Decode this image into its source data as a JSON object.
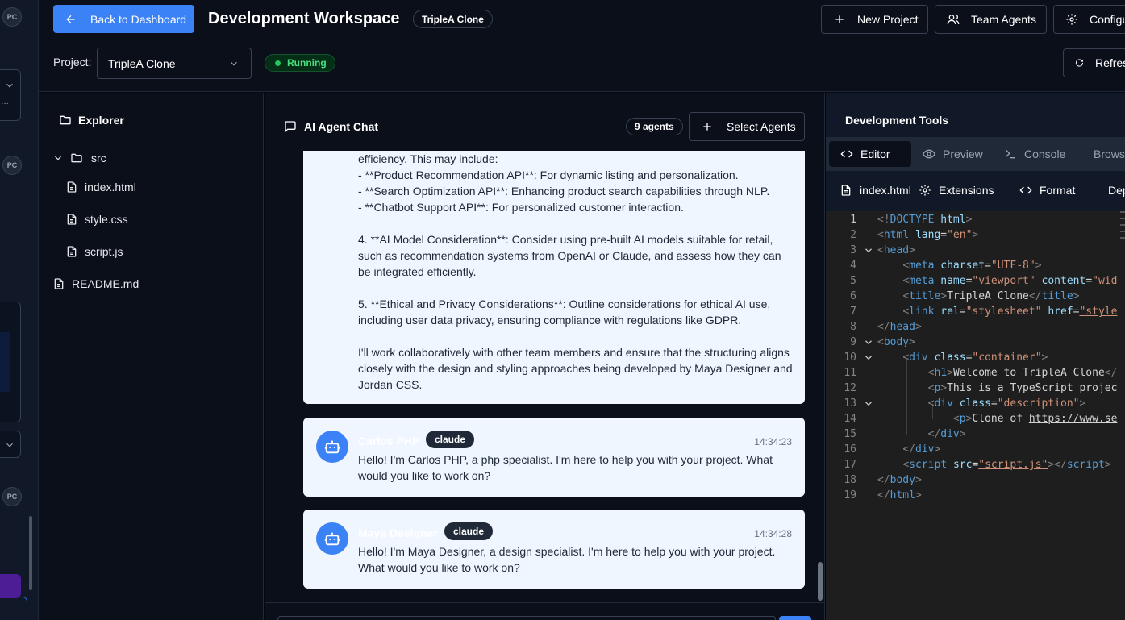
{
  "header": {
    "back_label": "Back to Dashboard",
    "title": "Development Workspace",
    "project_tag": "TripleA Clone",
    "new_project_label": "New Project",
    "team_agents_label": "Team Agents",
    "configure_label": "Configure",
    "refresh_label": "Refresh",
    "project_label": "Project:",
    "project_value": "TripleA Clone",
    "status": "Running"
  },
  "rail": {
    "avatars": [
      "PC",
      "PC",
      "PC"
    ]
  },
  "explorer": {
    "title": "Explorer",
    "folder": "src",
    "files": [
      "index.html",
      "style.css",
      "script.js"
    ],
    "root_files": [
      "README.md"
    ]
  },
  "chat": {
    "title": "AI Agent Chat",
    "agent_count": "9 agents",
    "select_agents_label": "Select Agents",
    "messages": [
      {
        "text": "efficiency. This may include:\n   - **Product Recommendation API**: For dynamic listing and personalization.\n   - **Search Optimization API**: Enhancing product search capabilities through NLP.\n   - **Chatbot Support API**: For personalized customer interaction.\n\n4. **AI Model Consideration**: Consider using pre-built AI models suitable for retail, such as recommendation systems from OpenAI or Claude, and assess how they can be integrated efficiently.\n\n5. **Ethical and Privacy Considerations**: Outline considerations for ethical AI use, including user data privacy, ensuring compliance with regulations like GDPR.\n\nI'll work collaboratively with other team members and ensure that the structuring aligns closely with the design and styling approaches being developed by Maya Designer and Jordan CSS."
      },
      {
        "agent": "Carlos PHP",
        "model": "claude",
        "time": "14:34:23",
        "text": "Hello! I'm Carlos PHP, a php specialist. I'm here to help you with your project. What would you like to work on?"
      },
      {
        "agent": "Maya Designer",
        "model": "claude",
        "time": "14:34:28",
        "text": "Hello! I'm Maya Designer, a design specialist. I'm here to help you with your project. What would you like to work on?"
      }
    ]
  },
  "devtools": {
    "title": "Development Tools",
    "tabs": [
      "Editor",
      "Preview",
      "Console",
      "Browser"
    ],
    "active_tab": "Editor",
    "file": "index.html",
    "tools": [
      "Extensions",
      "Format",
      "Deploy"
    ],
    "line_numbers": [
      "1",
      "2",
      "3",
      "4",
      "5",
      "6",
      "7",
      "8",
      "9",
      "10",
      "11",
      "12",
      "13",
      "14",
      "15",
      "16",
      "17",
      "18",
      "19"
    ]
  },
  "colors": {
    "accent": "#3b82f6",
    "status_green": "#22c55e",
    "message_bg": "#eff6ff",
    "editor_bg": "#1e1e1e"
  }
}
